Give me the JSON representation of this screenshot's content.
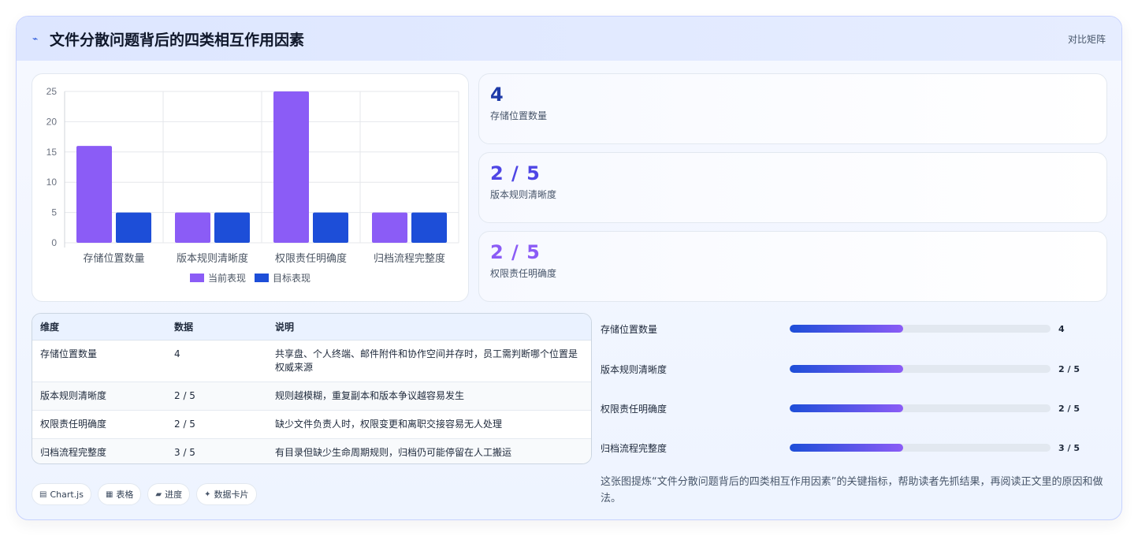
{
  "header": {
    "icon": "pulse-icon",
    "title": "文件分散问题背后的四类相互作用因素",
    "tag": "对比矩阵"
  },
  "colors": {
    "current": "#8b5cf6",
    "target": "#1d4ed8",
    "stat_blue": "#1e3aa8",
    "stat_indigo": "#4f46e5",
    "stat_violet": "#8b5cf6"
  },
  "chart_data": {
    "type": "bar",
    "categories": [
      "存储位置数量",
      "版本规则清晰度",
      "权限责任明确度",
      "归档流程完整度"
    ],
    "series": [
      {
        "name": "当前表现",
        "values": [
          16,
          5,
          25,
          5
        ]
      },
      {
        "name": "目标表现",
        "values": [
          5,
          5,
          5,
          5
        ]
      }
    ],
    "ylim": [
      0,
      25
    ],
    "yticks": [
      "0",
      "5",
      "10",
      "15",
      "20",
      "25"
    ],
    "grid": true,
    "legend": "bottom"
  },
  "stats": [
    {
      "value": "4",
      "label": "存储位置数量"
    },
    {
      "value": "2 / 5",
      "label": "版本规则清晰度"
    },
    {
      "value": "2 / 5",
      "label": "权限责任明确度"
    }
  ],
  "table": {
    "headers": [
      "维度",
      "数据",
      "说明"
    ],
    "rows": [
      [
        "存储位置数量",
        "4",
        "共享盘、个人终端、邮件附件和协作空间并存时，员工需判断哪个位置是权威来源"
      ],
      [
        "版本规则清晰度",
        "2 / 5",
        "规则越模糊，重复副本和版本争议越容易发生"
      ],
      [
        "权限责任明确度",
        "2 / 5",
        "缺少文件负责人时，权限变更和离职交接容易无人处理"
      ],
      [
        "归档流程完整度",
        "3 / 5",
        "有目录但缺少生命周期规则，归档仍可能停留在人工搬运"
      ]
    ]
  },
  "progress": [
    {
      "label": "存储位置数量",
      "value": "4",
      "fill": 0.435
    },
    {
      "label": "版本规则清晰度",
      "value": "2 / 5",
      "fill": 0.435
    },
    {
      "label": "权限责任明确度",
      "value": "2 / 5",
      "fill": 0.435
    },
    {
      "label": "归档流程完整度",
      "value": "3 / 5",
      "fill": 0.435
    }
  ],
  "chips": [
    {
      "icon": "chart-icon",
      "glyph": "▤",
      "label": "Chart.js"
    },
    {
      "icon": "table-icon",
      "glyph": "▦",
      "label": "表格"
    },
    {
      "icon": "progress-icon",
      "glyph": "▰",
      "label": "进度"
    },
    {
      "icon": "sparkle-icon",
      "glyph": "✦",
      "label": "数据卡片"
    }
  ],
  "note": "这张图提炼“文件分散问题背后的四类相互作用因素”的关键指标，帮助读者先抓结果，再阅读正文里的原因和做法。"
}
